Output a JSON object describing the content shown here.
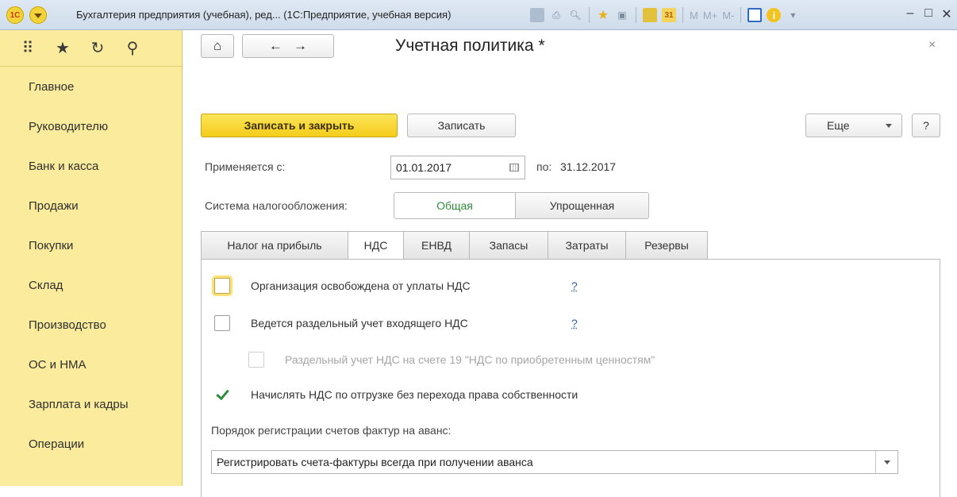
{
  "window": {
    "logo_text": "1С",
    "title": "Бухгалтерия предприятия (учебная), ред... (1С:Предприятие, учебная версия)",
    "toolbar_m_labels": [
      "M",
      "M+",
      "M-"
    ],
    "calendar_text": "31",
    "info_text": "i",
    "controls": {
      "minimize": "–",
      "maximize": "□",
      "close": "✕"
    }
  },
  "sidebar": {
    "icons": [
      "apps-grid-icon",
      "star-icon",
      "history-icon",
      "search-icon"
    ],
    "items": [
      {
        "label": "Главное"
      },
      {
        "label": "Руководителю"
      },
      {
        "label": "Банк и касса"
      },
      {
        "label": "Продажи"
      },
      {
        "label": "Покупки"
      },
      {
        "label": "Склад"
      },
      {
        "label": "Производство"
      },
      {
        "label": "ОС и НМА"
      },
      {
        "label": "Зарплата и кадры"
      },
      {
        "label": "Операции"
      }
    ]
  },
  "form": {
    "title": "Учетная политика *",
    "close_glyph": "×",
    "save_close_label": "Записать и закрыть",
    "save_label": "Записать",
    "more_label": "Еще",
    "help_label": "?",
    "applies_from_label": "Применяется с:",
    "applies_from_value": "01.01.2017",
    "applies_to_label": "по:",
    "applies_to_value": "31.12.2017",
    "tax_system_label": "Система налогообложения:",
    "tax_system_options": [
      "Общая",
      "Упрощенная"
    ],
    "tax_system_selected": "Общая",
    "tabs": [
      {
        "label": "Налог на прибыль",
        "active": false
      },
      {
        "label": "НДС",
        "active": true
      },
      {
        "label": "ЕНВД",
        "active": false
      },
      {
        "label": "Запасы",
        "active": false
      },
      {
        "label": "Затраты",
        "active": false
      },
      {
        "label": "Резервы",
        "active": false
      }
    ],
    "vat": {
      "exempt_label": "Организация освобождена от уплаты НДС",
      "exempt_checked": false,
      "separate_label": "Ведется раздельный учет входящего НДС",
      "separate_checked": false,
      "separate19_label": "Раздельный учет НДС на счете 19 \"НДС по приобретенным ценностям\"",
      "separate19_checked": false,
      "shipment_label": "Начислять НДС по отгрузке без перехода права собственности",
      "shipment_checked": true,
      "help_mark": "?",
      "invoice_order_label": "Порядок регистрации счетов фактур на аванс:",
      "invoice_order_value": "Регистрировать счета-фактуры всегда при получении аванса"
    }
  },
  "colors": {
    "sidebar_bg": "#fbeb9c",
    "primary_button": "#f4cc1a",
    "accent_green": "#2f8a3c",
    "link_blue": "#2e5fb1"
  }
}
